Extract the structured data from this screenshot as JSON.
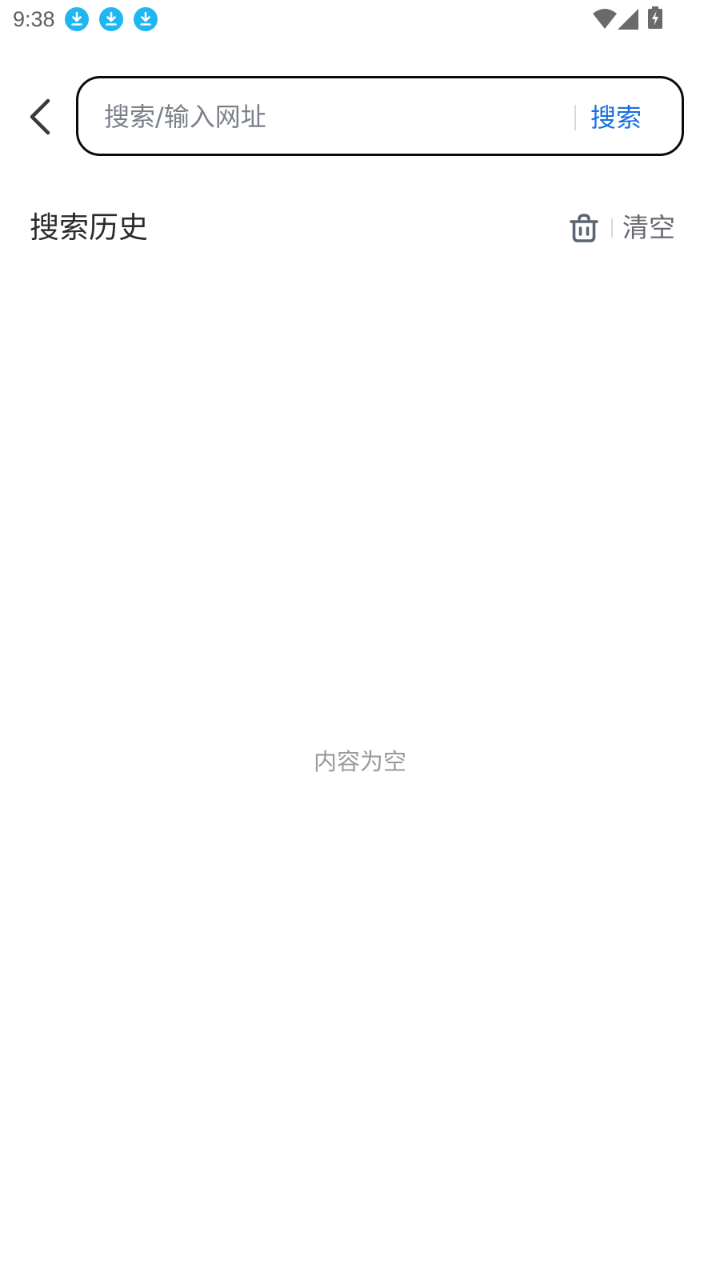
{
  "status_bar": {
    "time": "9:38",
    "colors": {
      "download": "#1fb6f2",
      "system_icons": "#6a6a6a"
    }
  },
  "header": {
    "back_icon": "chevron-left-icon",
    "search": {
      "placeholder": "搜索/输入网址",
      "value": "",
      "button_label": "搜索",
      "button_color": "#1a6fe0"
    }
  },
  "history": {
    "title": "搜索历史",
    "clear_icon": "trash-icon",
    "clear_label": "清空"
  },
  "empty_state": {
    "text": "内容为空"
  }
}
